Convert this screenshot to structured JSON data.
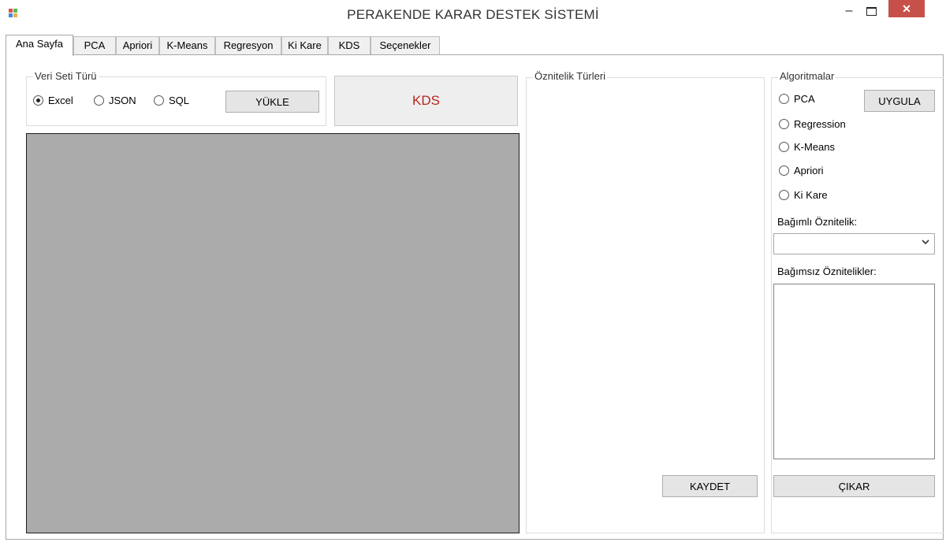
{
  "window": {
    "title": "PERAKENDE KARAR DESTEK SİSTEMİ",
    "minimize_glyph": "–",
    "close_glyph": "✕"
  },
  "tabs": [
    {
      "label": "Ana Sayfa"
    },
    {
      "label": "PCA"
    },
    {
      "label": "Apriori"
    },
    {
      "label": "K-Means"
    },
    {
      "label": "Regresyon"
    },
    {
      "label": "Ki Kare"
    },
    {
      "label": "KDS"
    },
    {
      "label": "Seçenekler"
    }
  ],
  "dataset": {
    "legend": "Veri Seti Türü",
    "options": [
      "Excel",
      "JSON",
      "SQL"
    ],
    "selected": "Excel",
    "load_label": "YÜKLE"
  },
  "kds_button": {
    "label": "KDS",
    "color": "#b5261e"
  },
  "attribute_types": {
    "legend": "Öznitelik Türleri",
    "save_label": "KAYDET"
  },
  "algorithms": {
    "legend": "Algoritmalar",
    "options": [
      "PCA",
      "Regression",
      "K-Means",
      "Apriori",
      "Ki Kare"
    ],
    "apply_label": "UYGULA",
    "dependent_label": "Bağımlı Öznitelik:",
    "dependent_value": "",
    "independent_label": "Bağımsız Öznitelikler:",
    "remove_label": "ÇIKAR"
  },
  "colors": {
    "grid_background": "#ababab",
    "close_button": "#c7504a"
  },
  "icons": {
    "app": "windows-form-icon",
    "dropdown": "chevron-down-icon"
  }
}
